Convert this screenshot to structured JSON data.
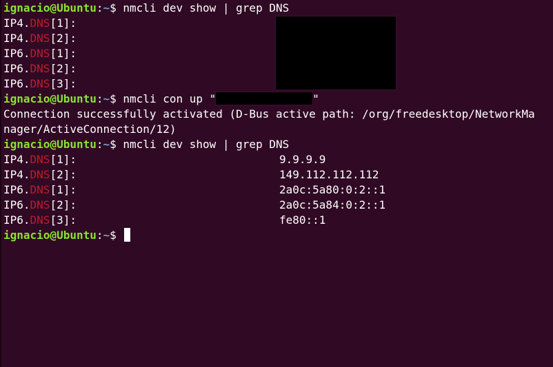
{
  "prompt": {
    "user": "ignacio@Ubuntu",
    "colon": ":",
    "path": "~",
    "symbol": "$ "
  },
  "block1": {
    "command": "nmcli dev show | grep DNS",
    "rows": [
      {
        "prefix": "IP4.",
        "key": "DNS",
        "suffix": "[1]:"
      },
      {
        "prefix": "IP4.",
        "key": "DNS",
        "suffix": "[2]:"
      },
      {
        "prefix": "IP6.",
        "key": "DNS",
        "suffix": "[1]:"
      },
      {
        "prefix": "IP6.",
        "key": "DNS",
        "suffix": "[2]:"
      },
      {
        "prefix": "IP6.",
        "key": "DNS",
        "suffix": "[3]:"
      }
    ]
  },
  "block2": {
    "command_start": "nmcli con up \"",
    "command_end": "\"",
    "output_line1": "Connection successfully activated (D-Bus active path: /org/freedesktop/NetworkMa",
    "output_line2": "nager/ActiveConnection/12)"
  },
  "block3": {
    "command": "nmcli dev show | grep DNS",
    "rows": [
      {
        "prefix": "IP4.",
        "key": "DNS",
        "suffix": "[1]:",
        "value": "9.9.9.9"
      },
      {
        "prefix": "IP4.",
        "key": "DNS",
        "suffix": "[2]:",
        "value": "149.112.112.112"
      },
      {
        "prefix": "IP6.",
        "key": "DNS",
        "suffix": "[1]:",
        "value": "2a0c:5a80:0:2::1"
      },
      {
        "prefix": "IP6.",
        "key": "DNS",
        "suffix": "[2]:",
        "value": "2a0c:5a84:0:2::1"
      },
      {
        "prefix": "IP6.",
        "key": "DNS",
        "suffix": "[3]:",
        "value": "fe80::1"
      }
    ]
  },
  "colors": {
    "background": "#300a24",
    "user": "#8ae234",
    "path": "#729fcf",
    "highlight": "#c01c28",
    "text": "#ffffff"
  }
}
